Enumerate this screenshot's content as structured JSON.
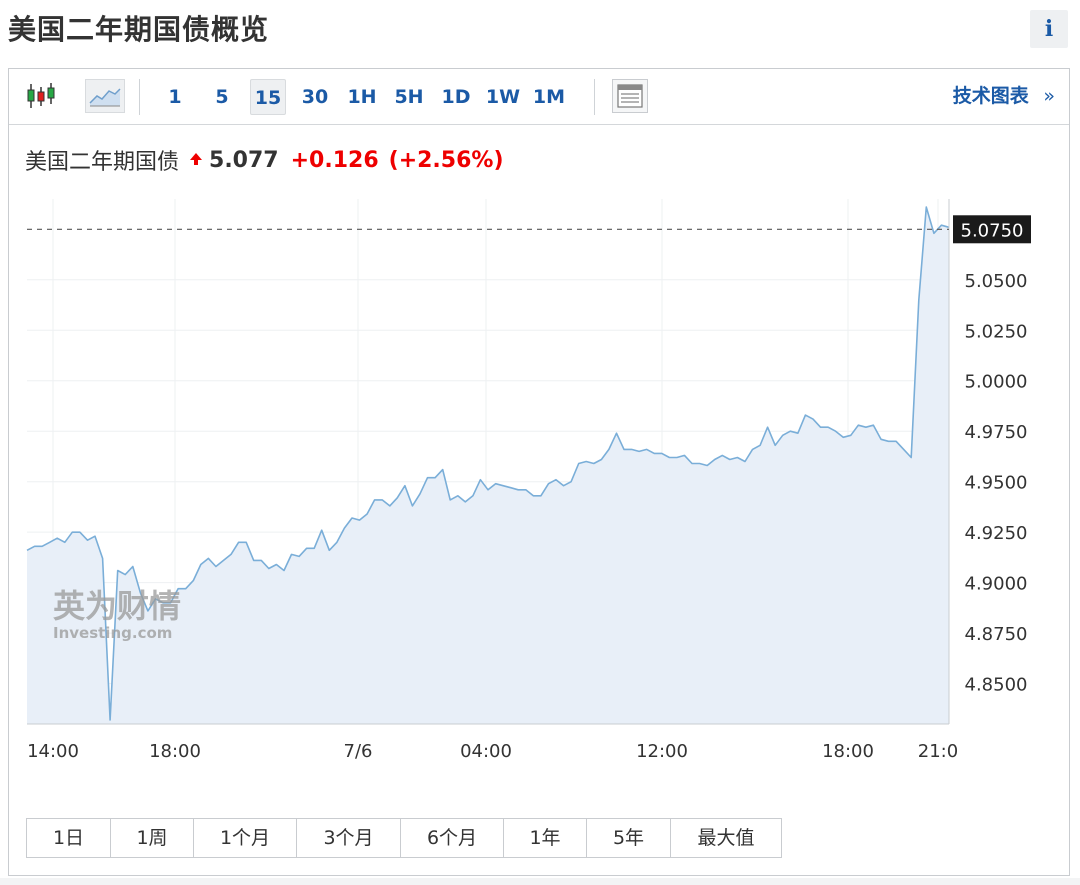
{
  "header": {
    "title": "美国二年期国债概览",
    "info_label": "i"
  },
  "toolbar": {
    "intervals": [
      "1",
      "5",
      "15",
      "30",
      "1H",
      "5H",
      "1D",
      "1W",
      "1M"
    ],
    "active_interval": "15",
    "tech_chart_label": "技术图表",
    "tech_chart_arrow": "»"
  },
  "quote": {
    "name": "美国二年期国债",
    "direction": "up",
    "price": "5.077",
    "change": "+0.126",
    "change_pct": "(+2.56%)"
  },
  "watermark": {
    "brand": "英为财情",
    "sub": "Investing.com"
  },
  "colors": {
    "up": "#ee0000",
    "accent": "#1b5aa6",
    "line": "#7aaed8",
    "area": "#e8eff8"
  },
  "chart_data": {
    "type": "area",
    "ylim": [
      4.83,
      5.09
    ],
    "y_ticks": [
      "5.0750",
      "5.0500",
      "5.0250",
      "5.0000",
      "4.9750",
      "4.9500",
      "4.9250",
      "4.9000",
      "4.8750",
      "4.8500"
    ],
    "x_ticks": [
      "14:00",
      "18:00",
      "7/6",
      "04:00",
      "12:00",
      "18:00",
      "21:0"
    ],
    "last_value_label": "5.0750",
    "last_value": 5.075,
    "series": [
      {
        "values": [
          4.916,
          4.918,
          4.918,
          4.92,
          4.922,
          4.92,
          4.925,
          4.925,
          4.921,
          4.923,
          4.912,
          4.832,
          4.906,
          4.904,
          4.908,
          4.895,
          4.886,
          4.892,
          4.89,
          4.89,
          4.897,
          4.897,
          4.901,
          4.909,
          4.912,
          4.908,
          4.911,
          4.914,
          4.92,
          4.92,
          4.911,
          4.911,
          4.907,
          4.909,
          4.906,
          4.914,
          4.913,
          4.917,
          4.917,
          4.926,
          4.916,
          4.92,
          4.927,
          4.932,
          4.931,
          4.934,
          4.941,
          4.941,
          4.938,
          4.942,
          4.948,
          4.938,
          4.944,
          4.952,
          4.952,
          4.956,
          4.941,
          4.943,
          4.94,
          4.943,
          4.951,
          4.946,
          4.949,
          4.948,
          4.947,
          4.946,
          4.946,
          4.943,
          4.943,
          4.949,
          4.951,
          4.948,
          4.95,
          4.959,
          4.96,
          4.959,
          4.961,
          4.966,
          4.974,
          4.966,
          4.966,
          4.965,
          4.966,
          4.964,
          4.964,
          4.962,
          4.962,
          4.963,
          4.959,
          4.959,
          4.958,
          4.961,
          4.963,
          4.961,
          4.962,
          4.96,
          4.966,
          4.968,
          4.977,
          4.968,
          4.973,
          4.975,
          4.974,
          4.983,
          4.981,
          4.977,
          4.977,
          4.975,
          4.972,
          4.973,
          4.978,
          4.977,
          4.978,
          4.971,
          4.97,
          4.97,
          4.966,
          4.962,
          5.04,
          5.086,
          5.073,
          5.077,
          5.076
        ]
      }
    ]
  },
  "ranges": [
    "1日",
    "1周",
    "1个月",
    "3个月",
    "6个月",
    "1年",
    "5年",
    "最大值"
  ]
}
